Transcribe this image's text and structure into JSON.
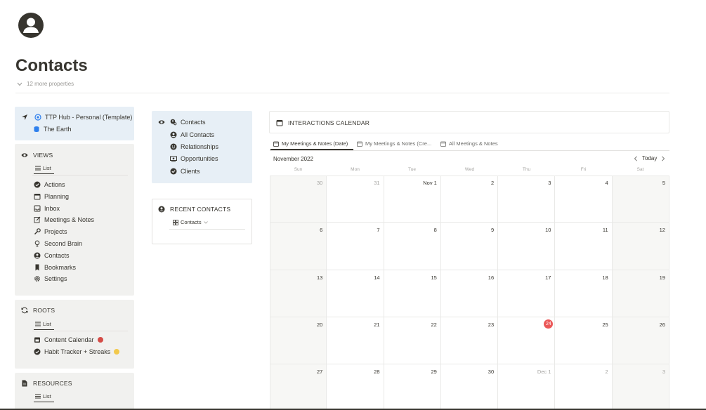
{
  "page": {
    "title": "Contacts",
    "more_properties": "12 more properties"
  },
  "left": {
    "hub": {
      "link": "TTP Hub - Personal (Template)",
      "earth": "The Earth"
    },
    "views": {
      "header": "VIEWS",
      "tab": "List",
      "items": [
        "Actions",
        "Planning",
        "Inbox",
        "Meetings & Notes",
        "Projects",
        "Second Brain",
        "Contacts",
        "Bookmarks",
        "Settings"
      ]
    },
    "roots": {
      "header": "ROOTS",
      "tab": "List",
      "items": [
        {
          "label": "Content Calendar",
          "dot": "#d44c47"
        },
        {
          "label": "Habit Tracker + Streaks",
          "dot": "#f2c94c"
        }
      ]
    },
    "resources": {
      "header": "RESOURCES",
      "tab": "List"
    }
  },
  "middle": {
    "nav": {
      "title": "Contacts",
      "items": [
        "All Contacts",
        "Relationships",
        "Opportunities",
        "Clients"
      ]
    },
    "recent": {
      "header": "RECENT CONTACTS",
      "view": "Contacts"
    }
  },
  "calendar": {
    "title": "INTERACTIONS CALENDAR",
    "tabs": [
      "My Meetings & Notes (Date)",
      "My Meetings & Notes (Cre...",
      "All Meetings & Notes"
    ],
    "month": "November 2022",
    "today_label": "Today",
    "weekdays": [
      "Sun",
      "Mon",
      "Tue",
      "Wed",
      "Thu",
      "Fri",
      "Sat"
    ],
    "weeks": [
      [
        "30",
        "31",
        "Nov 1",
        "2",
        "3",
        "4",
        "5"
      ],
      [
        "6",
        "7",
        "8",
        "9",
        "10",
        "11",
        "12"
      ],
      [
        "13",
        "14",
        "15",
        "16",
        "17",
        "18",
        "19"
      ],
      [
        "20",
        "21",
        "22",
        "23",
        "24",
        "25",
        "26"
      ],
      [
        "27",
        "28",
        "29",
        "30",
        "Dec 1",
        "2",
        "3"
      ]
    ],
    "today": "24",
    "accent": "#eb5757"
  }
}
